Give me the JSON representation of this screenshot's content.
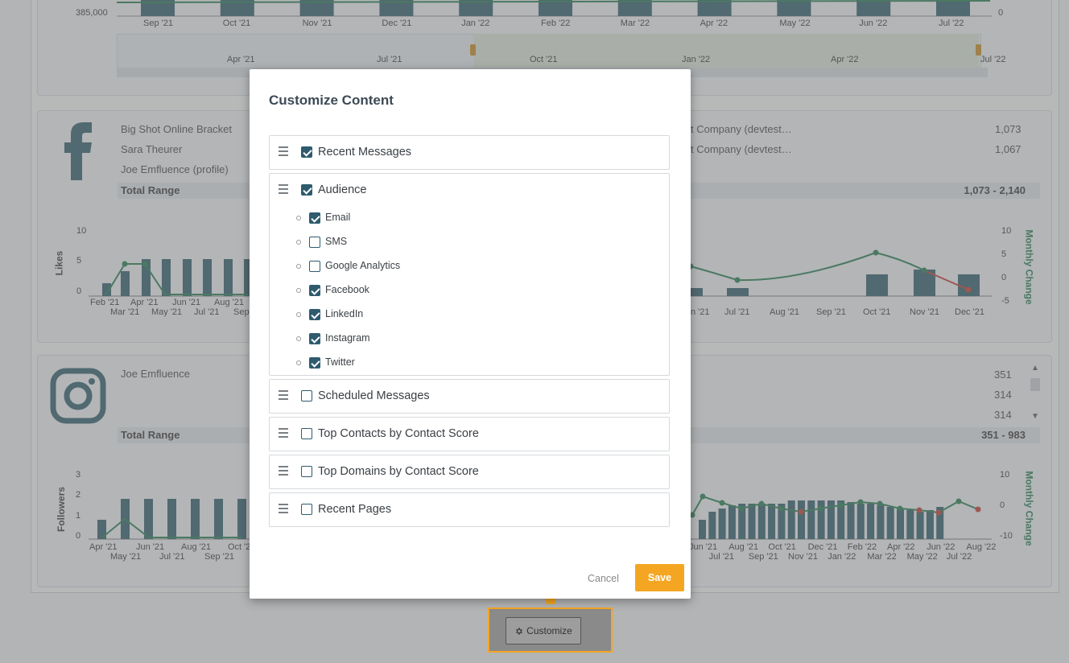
{
  "background": {
    "top_chart": {
      "y_left_tick": "385,000",
      "y_right_tick": "0",
      "x_labels": [
        "Sep '21",
        "Oct '21",
        "Nov '21",
        "Dec '21",
        "Jan '22",
        "Feb '22",
        "Mar '22",
        "Apr '22",
        "May '22",
        "Jun '22",
        "Jul '22"
      ],
      "navigator_labels": [
        "Apr '21",
        "Jul '21",
        "Oct '21",
        "Jan '22",
        "Apr '22",
        "Jul '22"
      ]
    },
    "facebook_panel": {
      "icon": "facebook-icon",
      "rows_left": [
        "Big Shot Online Bracket",
        "Sara Theurer",
        "Joe Emfluence (profile)"
      ],
      "rows_right": [
        {
          "label": "t Company (devtest…",
          "value": "1,073"
        },
        {
          "label": "t Company (devtest…",
          "value": "1,067"
        }
      ],
      "total_label": "Total Range",
      "total_value": "1,073 - 2,140",
      "y_label_left": "Likes",
      "y_label_right": "Monthly Change",
      "y_left_ticks": [
        "10",
        "5",
        "0"
      ],
      "y_right_ticks": [
        "10",
        "5",
        "0",
        "-5"
      ],
      "x_labels_left": [
        "Feb '21",
        "Mar '21",
        "Apr '21",
        "May '21",
        "Jun '21",
        "Jul '21",
        "Aug '21",
        "Sep"
      ],
      "x_labels_right": [
        "n '21",
        "Jul '21",
        "Aug '21",
        "Sep '21",
        "Oct '21",
        "Nov '21",
        "Dec '21"
      ]
    },
    "instagram_panel": {
      "icon": "instagram-icon",
      "rows_left": [
        "Joe Emfluence"
      ],
      "rows_right_values": [
        "351",
        "314",
        "314"
      ],
      "total_label": "Total Range",
      "total_value": "351 - 983",
      "y_label_left": "Followers",
      "y_label_right": "Monthly Change",
      "y_left_ticks": [
        "3",
        "2",
        "1",
        "0"
      ],
      "y_right_ticks": [
        "10",
        "0",
        "-10"
      ],
      "x_labels_left": [
        "Apr '21",
        "May '21",
        "Jun '21",
        "Jul '21",
        "Aug '21",
        "Sep '21",
        "Oct '2"
      ],
      "x_labels_right": [
        "Jun '21",
        "Jul '21",
        "Aug '21",
        "Sep '21",
        "Oct '21",
        "Nov '21",
        "Dec '21",
        "Jan '22",
        "Feb '22",
        "Mar '22",
        "Apr '22",
        "May '22",
        "Jun '22",
        "Jul '22",
        "Aug '22"
      ]
    }
  },
  "modal": {
    "title": "Customize Content",
    "items": [
      {
        "label": "Recent Messages",
        "checked": true
      },
      {
        "label": "Audience",
        "checked": true,
        "children": [
          {
            "label": "Email",
            "checked": true
          },
          {
            "label": "SMS",
            "checked": false
          },
          {
            "label": "Google Analytics",
            "checked": false
          },
          {
            "label": "Facebook",
            "checked": true
          },
          {
            "label": "LinkedIn",
            "checked": true
          },
          {
            "label": "Instagram",
            "checked": true
          },
          {
            "label": "Twitter",
            "checked": true
          }
        ]
      },
      {
        "label": "Scheduled Messages",
        "checked": false
      },
      {
        "label": "Top Contacts by Contact Score",
        "checked": false
      },
      {
        "label": "Top Domains by Contact Score",
        "checked": false
      },
      {
        "label": "Recent Pages",
        "checked": false
      }
    ],
    "cancel_label": "Cancel",
    "save_label": "Save"
  },
  "customize_button": {
    "label": "Customize",
    "icon": "gear-icon"
  },
  "colors": {
    "bar": "#2b5b68",
    "line_positive": "#1f7a4d",
    "line_negative": "#c0392b",
    "accent": "#f4a623",
    "checkbox": "#2e5b6e"
  }
}
